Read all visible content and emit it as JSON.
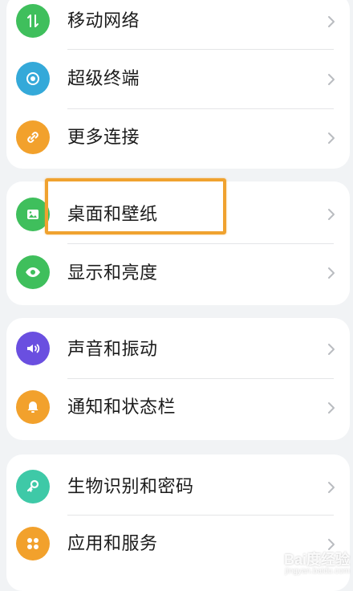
{
  "settings": {
    "groups": [
      {
        "items": [
          {
            "label": "移动网络",
            "icon": "mobile-data-icon",
            "color": "#3fbf5c"
          },
          {
            "label": "超级终端",
            "icon": "super-device-icon",
            "color": "#34a9d9"
          },
          {
            "label": "更多连接",
            "icon": "link-icon",
            "color": "#f2a12c"
          }
        ]
      },
      {
        "items": [
          {
            "label": "桌面和壁纸",
            "icon": "wallpaper-icon",
            "color": "#3fbf5c"
          },
          {
            "label": "显示和亮度",
            "icon": "eye-icon",
            "color": "#3fbf5c"
          }
        ]
      },
      {
        "items": [
          {
            "label": "声音和振动",
            "icon": "speaker-icon",
            "color": "#6a4fe0"
          },
          {
            "label": "通知和状态栏",
            "icon": "bell-icon",
            "color": "#f2a12c"
          }
        ]
      },
      {
        "items": [
          {
            "label": "生物识别和密码",
            "icon": "key-icon",
            "color": "#3ec9a7"
          },
          {
            "label": "应用和服务",
            "icon": "apps-icon",
            "color": "#f2a12c"
          }
        ]
      }
    ]
  },
  "highlight": {
    "target": "桌面和壁纸",
    "color": "#f0a22f"
  },
  "watermark": {
    "main": "Bai度经验",
    "sub": "jingyan.baidu.com"
  }
}
